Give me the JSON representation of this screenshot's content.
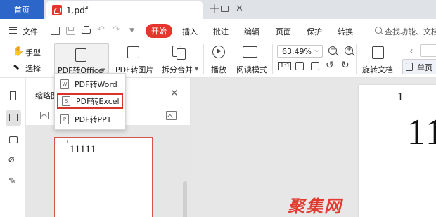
{
  "tabs": {
    "home_label": "首页",
    "doc_title": "1.pdf",
    "close": "✕",
    "add": "+"
  },
  "menu": {
    "file": "文件",
    "start": "开始",
    "items": [
      "插入",
      "批注",
      "编辑",
      "页面",
      "保护",
      "转换"
    ],
    "search": "查找功能、文档"
  },
  "toolbar": {
    "hand": "手型",
    "select": "选择",
    "pdf_to_office": "PDF转Office",
    "pdf_to_image": "PDF转图片",
    "split_merge": "拆分合并",
    "play": "播放",
    "read_mode": "阅读模式",
    "zoom": "63.49%",
    "rotate_doc": "旋转文档",
    "single_page": "单页"
  },
  "dropdown": {
    "items": [
      {
        "label": "PDF转Word",
        "icon": "W"
      },
      {
        "label": "PDF转Excel",
        "icon": "S"
      },
      {
        "label": "PDF转PPT",
        "icon": "P"
      }
    ]
  },
  "thumbnail_panel": {
    "title": "缩略图",
    "close": "✕",
    "page_number": "1",
    "page_text": "11111"
  },
  "document": {
    "page_number": "1",
    "page_text": "11"
  },
  "watermark": "聚集网",
  "colors": {
    "accent_blue": "#2b66c8",
    "accent_red": "#e5362d",
    "highlight_red": "#d9342b"
  }
}
